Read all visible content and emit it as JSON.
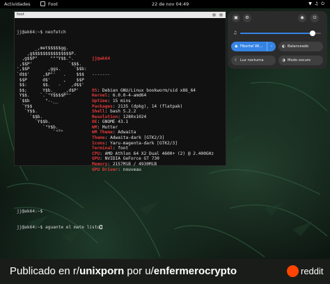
{
  "topbar": {
    "activities": "Actividades",
    "app_name": "Foot",
    "clock": "22 de nov  04:49",
    "network_icon": "network-icon",
    "volume_icon": "volume-icon",
    "power_icon": "power-icon"
  },
  "terminal": {
    "title": "foot",
    "prompt1": "jj@ak64:~$ neofetch",
    "ascii": [
      "       _,met$$$$$gg.",
      "    ,g$$$$$$$$$$$$$$$P.",
      "  ,g$$P\"     \"\"\"Y$$.\".",
      " ,$$P'              `$$$.",
      "',$$P       ,ggs.     `$$b:",
      "`d$$'     ,$P\"'   .    $$$",
      " $$P      d$'     ,    $$P",
      " $$:      $$.   -    ,d$$'",
      " $$;      Y$b._   _,d$P'",
      " Y$$.    `.`\"Y$$$$P\"'",
      " `$$b      \"-.__",
      "  `Y$$",
      "   `Y$$.",
      "     `$$b.",
      "       `Y$$b.",
      "          `\"Y$b._",
      "              `\"\"\""
    ],
    "userhost": "jj@ak64",
    "separator": "-------",
    "info": [
      {
        "k": "OS",
        "v": "Debian GNU/Linux bookworm/sid x86_64"
      },
      {
        "k": "Kernel",
        "v": "6.0.0-4-amd64"
      },
      {
        "k": "Uptime",
        "v": "15 mins"
      },
      {
        "k": "Packages",
        "v": "2135 (dpkg), 14 (flatpak)"
      },
      {
        "k": "Shell",
        "v": "bash 5.2.2"
      },
      {
        "k": "Resolution",
        "v": "1280x1024"
      },
      {
        "k": "DE",
        "v": "GNOME 43.1"
      },
      {
        "k": "WM",
        "v": "Mutter"
      },
      {
        "k": "WM Theme",
        "v": "Adwaita"
      },
      {
        "k": "Theme",
        "v": "Adwaita-dark [GTK2/3]"
      },
      {
        "k": "Icons",
        "v": "Yaru-magenta-dark [GTK2/3]"
      },
      {
        "k": "Terminal",
        "v": "foot"
      },
      {
        "k": "CPU",
        "v": "AMD Athlon 64 X2 Dual 4600+ (2) @ 2.400GHz"
      },
      {
        "k": "GPU",
        "v": "NVIDIA GeForce GT 730"
      },
      {
        "k": "Memory",
        "v": "2157MiB / 4930MiB"
      },
      {
        "k": "GPU Driver",
        "v": "nouveau"
      }
    ],
    "prompt2": "jj@ak64:~$",
    "prompt3": "jj@ak64:~$ aguante el mate listo"
  },
  "quick_settings": {
    "volume_level": 0.9,
    "buttons": [
      {
        "label": "Fibertel Wi...",
        "icon": "wifi-icon",
        "active": true,
        "has_menu": true
      },
      {
        "label": "Balanceado",
        "icon": "power-mode-icon",
        "active": false,
        "has_menu": false
      },
      {
        "label": "Luz nocturna",
        "icon": "night-light-icon",
        "active": false,
        "has_menu": false
      },
      {
        "label": "Modo oscuro",
        "icon": "dark-mode-icon",
        "active": false,
        "has_menu": false
      }
    ]
  },
  "banner": {
    "prefix": "Publicado en r/",
    "subreddit": "unixporn",
    "middle": " por u/",
    "user": "enfermerocrypto",
    "brand": "reddit"
  }
}
